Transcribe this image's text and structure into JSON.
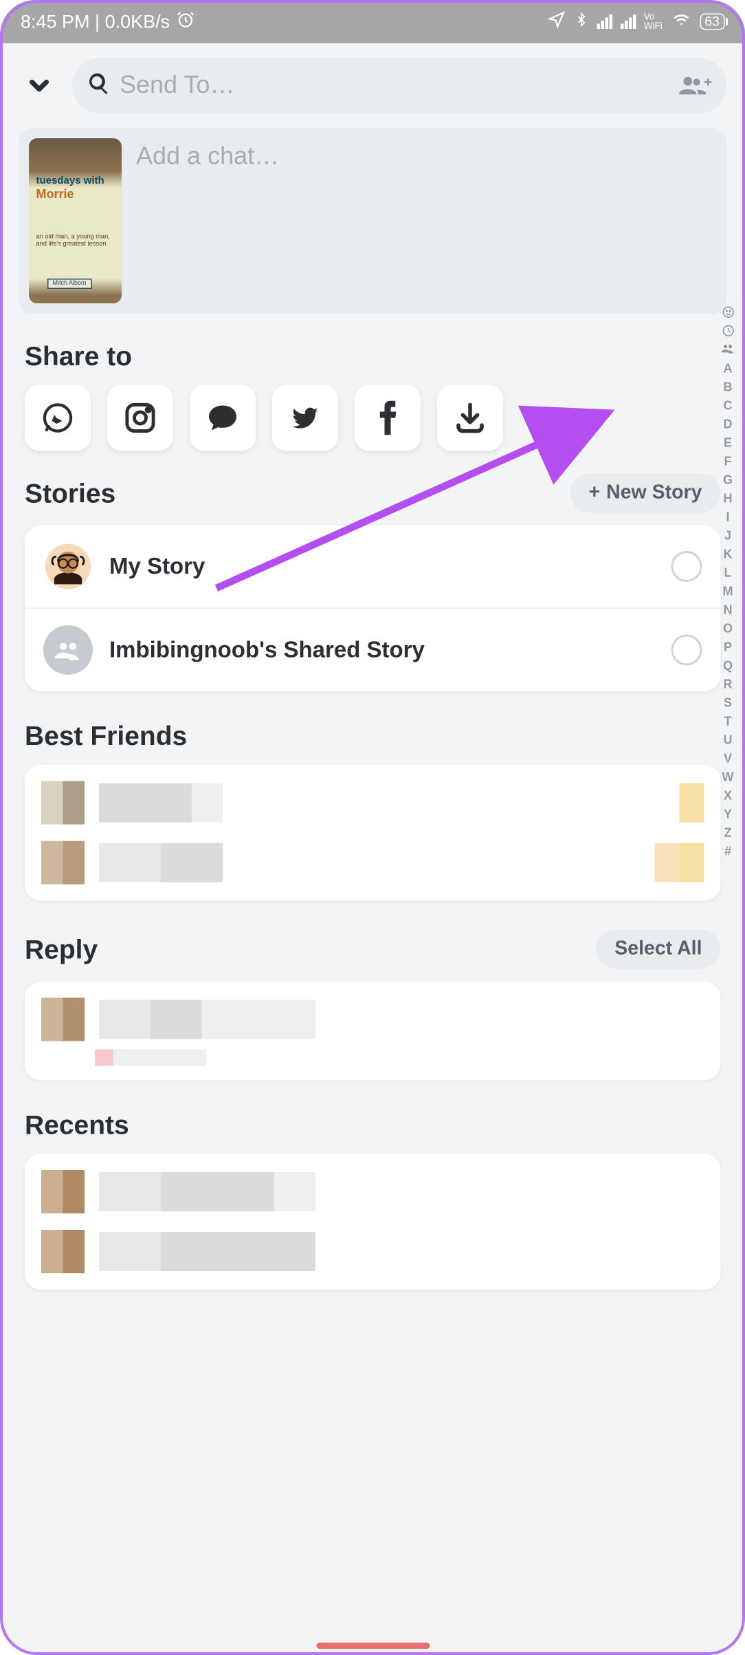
{
  "statusbar": {
    "time": "8:45 PM | 0.0KB/s",
    "battery": "63",
    "vowifi": "Vo\nWiFi"
  },
  "search": {
    "placeholder": "Send To…"
  },
  "chat": {
    "placeholder": "Add a chat…",
    "book_title": "tuesdays with",
    "book_title2": "Morrie",
    "book_sub": "an old man, a young man,\nand life's greatest lesson",
    "book_author": "Mitch Albom"
  },
  "share": {
    "heading": "Share to",
    "items": [
      "whatsapp",
      "instagram",
      "chat",
      "twitter",
      "facebook",
      "download"
    ]
  },
  "stories": {
    "heading": "Stories",
    "new": "New Story",
    "rows": [
      {
        "label": "My Story",
        "avatar": "bitmoji"
      },
      {
        "label": "Imbibingnoob's Shared Story",
        "avatar": "group"
      }
    ]
  },
  "bestfriends": {
    "heading": "Best Friends"
  },
  "reply": {
    "heading": "Reply",
    "select_all": "Select All"
  },
  "recents": {
    "heading": "Recents"
  },
  "alpha": [
    "A",
    "B",
    "C",
    "D",
    "E",
    "F",
    "G",
    "H",
    "I",
    "J",
    "K",
    "L",
    "M",
    "N",
    "O",
    "P",
    "Q",
    "R",
    "S",
    "T",
    "U",
    "V",
    "W",
    "X",
    "Y",
    "Z",
    "#"
  ]
}
